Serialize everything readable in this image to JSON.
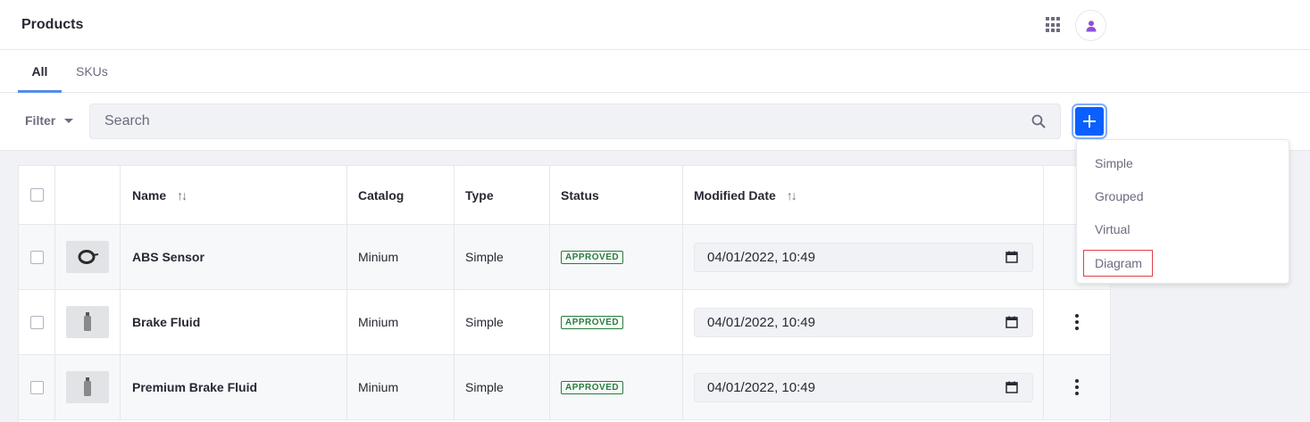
{
  "header": {
    "title": "Products"
  },
  "tabs": [
    {
      "label": "All",
      "active": true
    },
    {
      "label": "SKUs",
      "active": false
    }
  ],
  "toolbar": {
    "filter_label": "Filter",
    "search_placeholder": "Search",
    "add_icon": "plus-icon"
  },
  "table": {
    "columns": {
      "name": "Name",
      "catalog": "Catalog",
      "type": "Type",
      "status": "Status",
      "modified_date": "Modified Date"
    },
    "rows": [
      {
        "name": "ABS Sensor",
        "catalog": "Minium",
        "type": "Simple",
        "status": "APPROVED",
        "modified_date": "04/01/2022, 10:49"
      },
      {
        "name": "Brake Fluid",
        "catalog": "Minium",
        "type": "Simple",
        "status": "APPROVED",
        "modified_date": "04/01/2022, 10:49"
      },
      {
        "name": "Premium Brake Fluid",
        "catalog": "Minium",
        "type": "Simple",
        "status": "APPROVED",
        "modified_date": "04/01/2022, 10:49"
      }
    ]
  },
  "add_menu": {
    "items": [
      "Simple",
      "Grouped",
      "Virtual",
      "Diagram"
    ]
  },
  "colors": {
    "accent": "#0b5fff",
    "tab_indicator": "#528de9",
    "approved": "#287d3c",
    "highlight": "#e0404c",
    "avatar": "#8e4fd6"
  }
}
